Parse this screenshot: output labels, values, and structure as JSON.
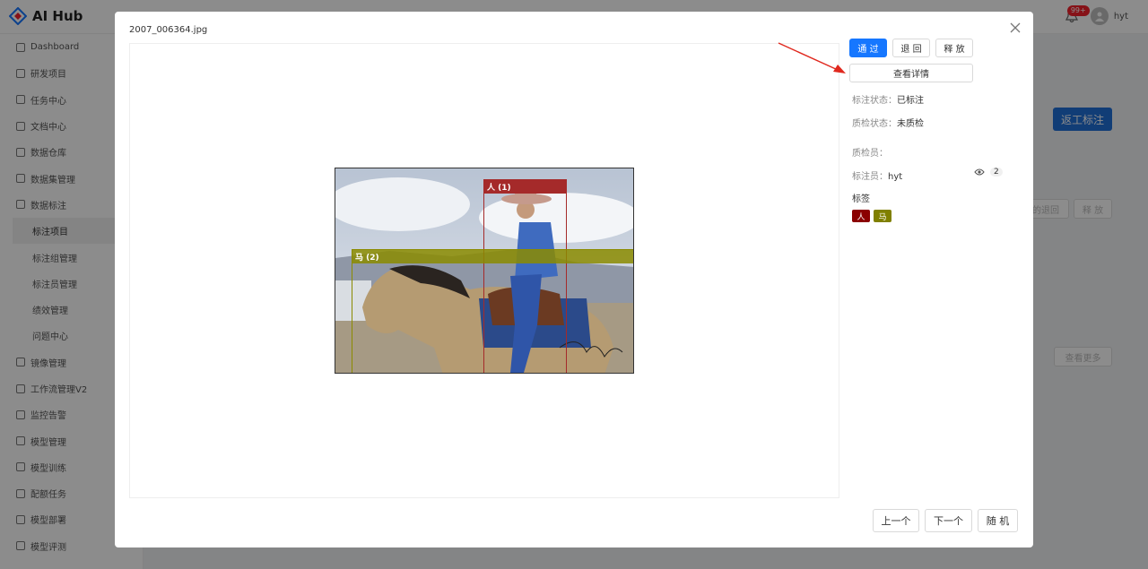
{
  "app": {
    "title": "AI Hub",
    "notifications": "99+",
    "user": "hyt"
  },
  "sidebar": {
    "items": [
      {
        "label": "Dashboard"
      },
      {
        "label": "研发项目"
      },
      {
        "label": "任务中心"
      },
      {
        "label": "文档中心"
      },
      {
        "label": "数据仓库"
      },
      {
        "label": "数据集管理"
      },
      {
        "label": "数据标注"
      },
      {
        "label": "标注项目"
      },
      {
        "label": "标注组管理"
      },
      {
        "label": "标注员管理"
      },
      {
        "label": "绩效管理"
      },
      {
        "label": "问题中心"
      },
      {
        "label": "镜像管理"
      },
      {
        "label": "工作流管理V2"
      },
      {
        "label": "监控告警"
      },
      {
        "label": "模型管理"
      },
      {
        "label": "模型训练"
      },
      {
        "label": "配额任务"
      },
      {
        "label": "模型部署"
      },
      {
        "label": "模型评测"
      }
    ]
  },
  "background": {
    "rework_label": "返工标注",
    "return_label": "的退回",
    "release_label": "释 放",
    "more_label": "查看更多"
  },
  "modal": {
    "filename": "2007_006364.jpg",
    "buttons": {
      "pass": "通 过",
      "return": "退 回",
      "release": "释 放",
      "details": "查看详情"
    },
    "annotation_status": {
      "key": "标注状态：",
      "value": "已标注"
    },
    "qc_status": {
      "key": "质检状态：",
      "value": "未质检"
    },
    "qc_person": {
      "key": "质检员：",
      "value": ""
    },
    "annotator": {
      "key": "标注员：",
      "value": "hyt",
      "views": "2"
    },
    "tags_title": "标签",
    "tags": [
      {
        "label": "人",
        "color": "#8b0000"
      },
      {
        "label": "马",
        "color": "#808000"
      }
    ],
    "boxes": [
      {
        "label": "人 (1)",
        "color": "#a52a2a"
      },
      {
        "label": "马 (2)",
        "color": "#8b8b00"
      }
    ],
    "nav": {
      "prev": "上一个",
      "next": "下一个",
      "random": "随 机"
    }
  }
}
